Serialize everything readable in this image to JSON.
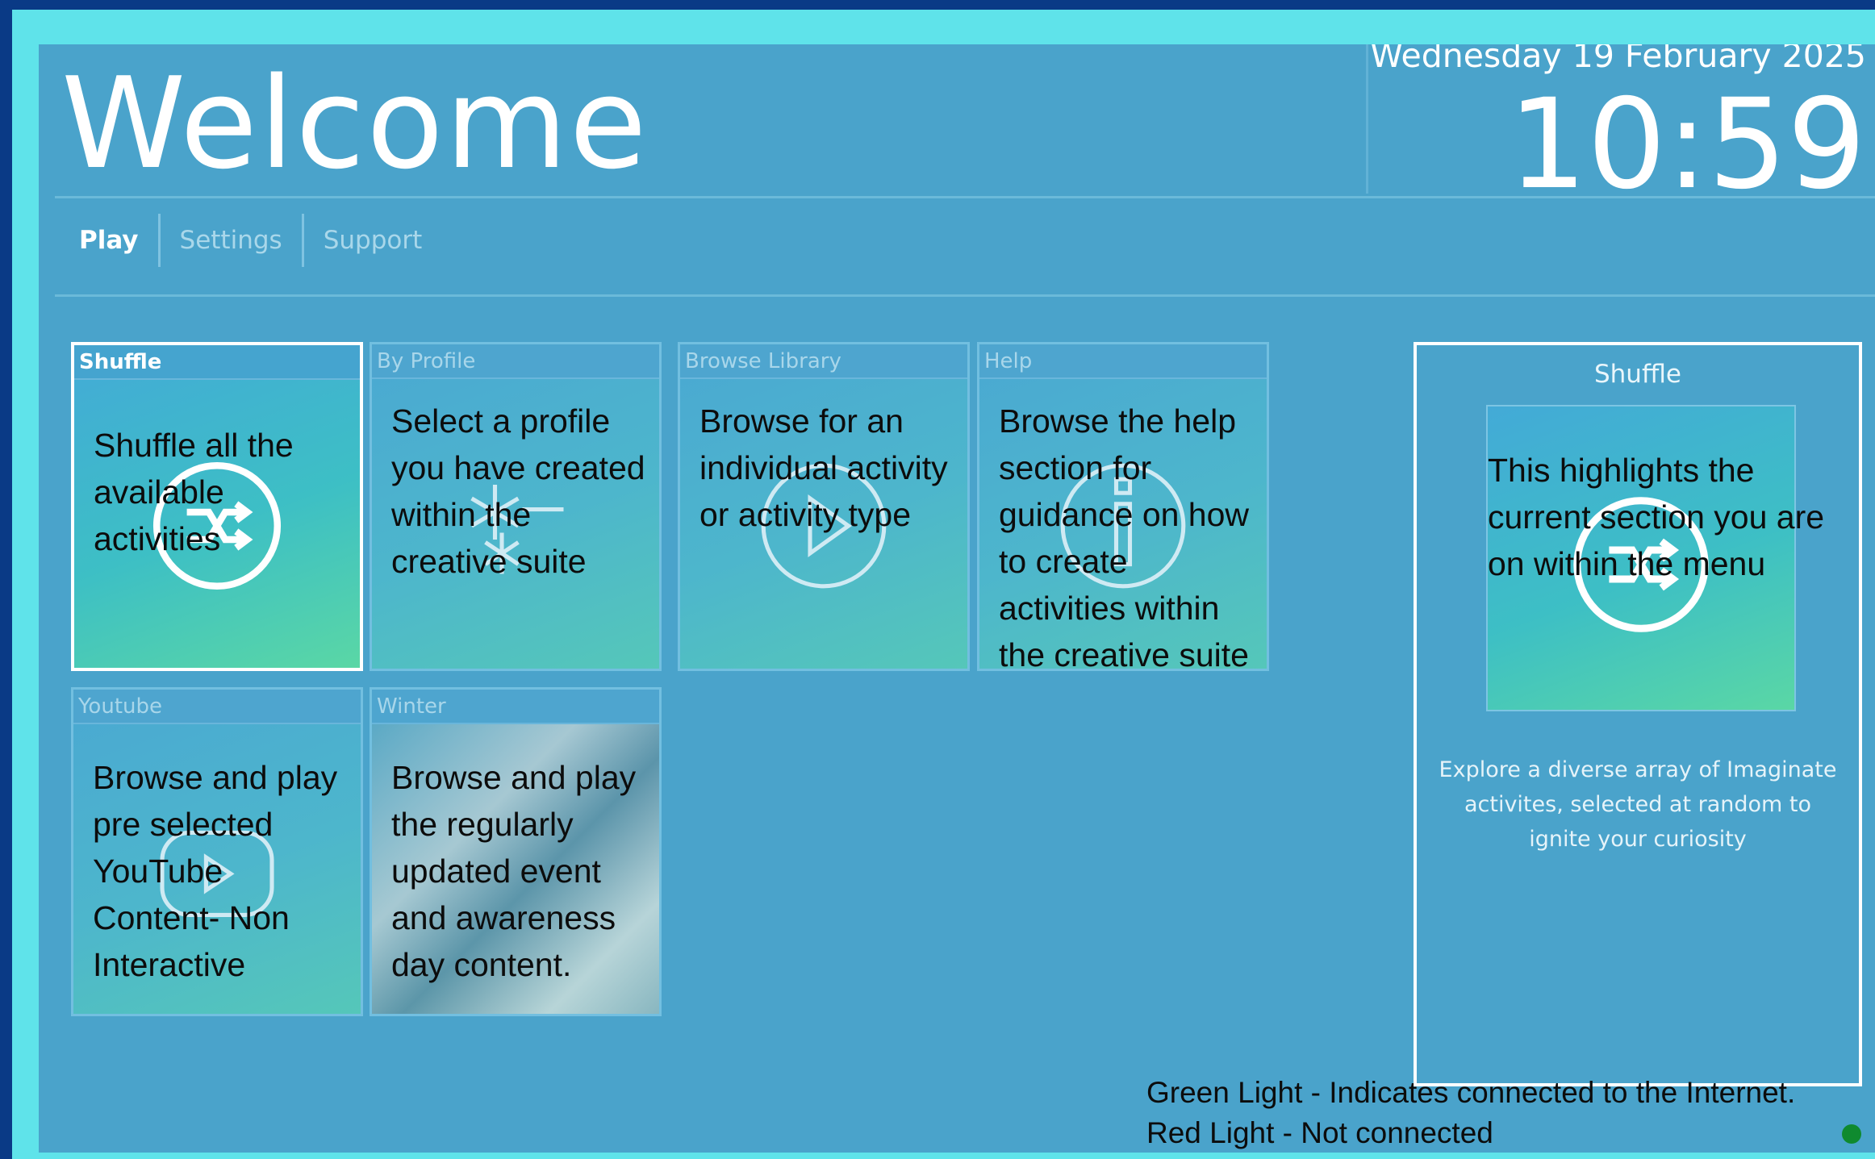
{
  "header": {
    "title": "Welcome",
    "date": "Wednesday 19 February 2025",
    "time": "10:59"
  },
  "tabs": [
    {
      "label": "Play",
      "active": true
    },
    {
      "label": "Settings",
      "active": false
    },
    {
      "label": "Support",
      "active": false
    }
  ],
  "tiles": [
    {
      "label": "Shuffle",
      "icon": "shuffle-icon",
      "description": "Shuffle all the available activities",
      "selected": true
    },
    {
      "label": "By Profile",
      "icon": "snowflake-icon",
      "description": "Select a profile you have created within the creative suite"
    },
    {
      "label": "Browse Library",
      "icon": "play-circle-icon",
      "description": "Browse for an individual activity or activity type"
    },
    {
      "label": "Help",
      "icon": "info-icon",
      "description": "Browse the help section for guidance on how to create activities within the creative suite"
    },
    {
      "label": "Youtube",
      "icon": "youtube-play-icon",
      "description": "Browse and play pre selected YouTube Content- Non Interactive"
    },
    {
      "label": "Winter",
      "icon": "winter-image",
      "description": "Browse and play the regularly updated event and awareness day content."
    }
  ],
  "preview": {
    "title": "Shuffle",
    "overlay_note": "This highlights the current section you are on within the menu",
    "caption": "Explore a diverse array of Imaginate activites, selected at random to ignite your curiosity"
  },
  "legend": {
    "green": "Green Light - Indicates connected to the Internet.",
    "red": "Red Light - Not connected"
  },
  "colors": {
    "status_light": "#0f8a2f",
    "background": "#4aa3cb",
    "frame": "#5fe3ea"
  }
}
